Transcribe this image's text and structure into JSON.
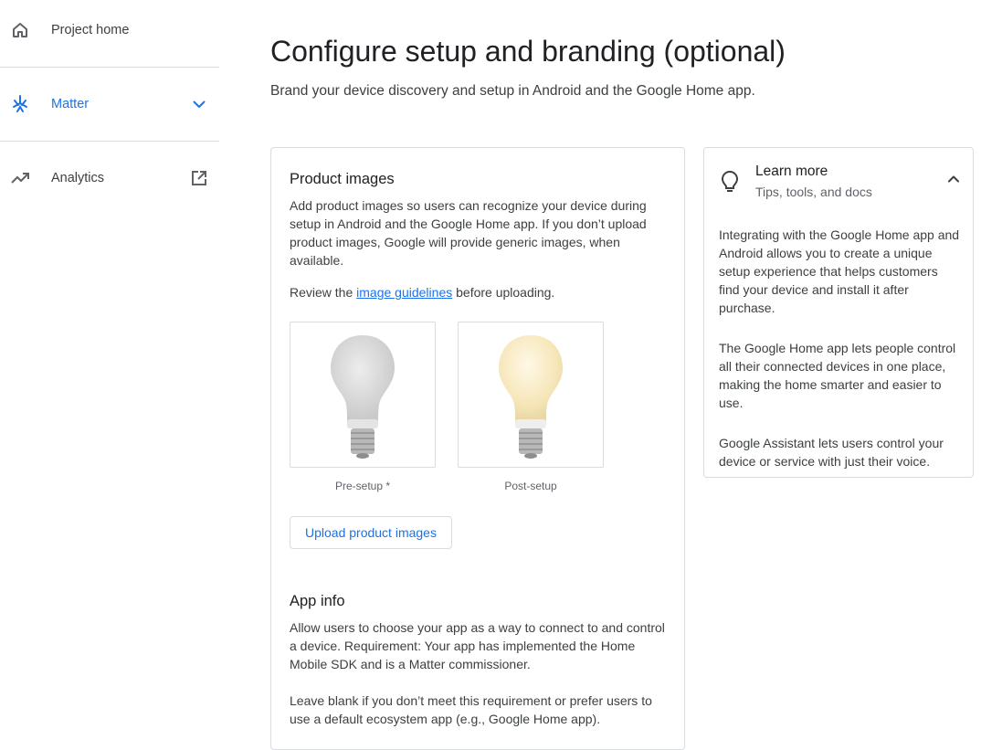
{
  "sidebar": {
    "items": [
      {
        "label": "Project home",
        "icon": "home-icon"
      },
      {
        "label": "Matter",
        "icon": "matter-icon",
        "trailing": "chevron-down-icon"
      },
      {
        "label": "Analytics",
        "icon": "trending-up-icon",
        "trailing": "open-in-new-icon"
      }
    ]
  },
  "main": {
    "title": "Configure setup and branding (optional)",
    "subtitle": "Brand your device discovery and setup in Android and the Google Home app.",
    "product_images": {
      "title": "Product images",
      "description": "Add product images so users can recognize your device during setup in Android and the Google Home app. If you don’t upload product images, Google will provide generic images, when available.",
      "review_prefix": "Review the",
      "review_link": "image guidelines",
      "review_suffix": "before uploading.",
      "images": [
        {
          "caption": "Pre-setup *",
          "state": "off"
        },
        {
          "caption": "Post-setup",
          "state": "on"
        }
      ],
      "upload_label": "Upload product images"
    },
    "app_info": {
      "title": "App info",
      "description": "Allow users to choose your app as a way to connect to and control a device. Requirement: Your app has implemented the Home Mobile SDK and is a Matter commissioner.",
      "note": "Leave blank if you don’t meet this requirement or prefer users to use a default ecosystem app (e.g., Google Home app)."
    }
  },
  "learn_more": {
    "title": "Learn more",
    "subtitle": "Tips, tools, and docs",
    "paragraphs": [
      "Integrating with the Google Home app and Android allows you to create a unique setup experience that helps customers find your device and install it after purchase.",
      "The Google Home app lets people control all their connected devices in one place, making the home smarter and easier to use.",
      "Google Assistant lets users control your device or service with just their voice."
    ]
  },
  "colors": {
    "accent": "#1a73e8",
    "text_primary": "#202124",
    "text_secondary": "#5f6368",
    "border": "#dadce0"
  }
}
